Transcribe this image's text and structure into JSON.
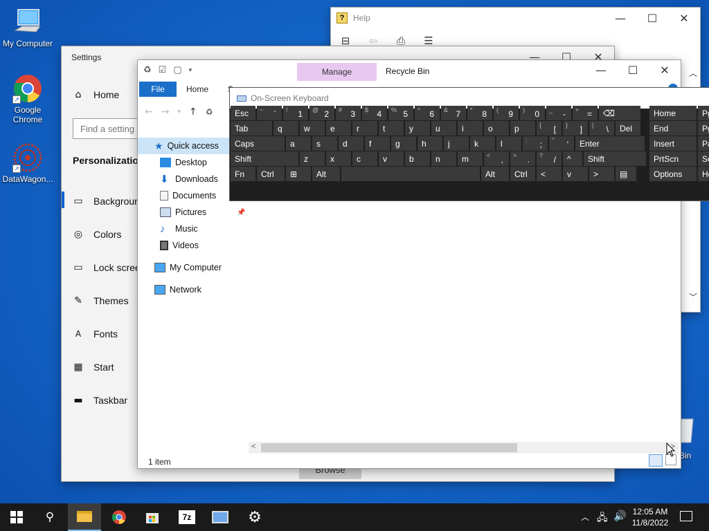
{
  "desktop": {
    "icons": [
      {
        "label": "My Computer"
      },
      {
        "label": "Google Chrome"
      },
      {
        "label": "DataWagon..."
      },
      {
        "label": "Bin"
      }
    ]
  },
  "help": {
    "title": "Help"
  },
  "settings": {
    "title": "Settings",
    "home": "Home",
    "search_placeholder": "Find a setting",
    "section": "Personalization",
    "nav": [
      {
        "label": "Background"
      },
      {
        "label": "Colors"
      },
      {
        "label": "Lock screen"
      },
      {
        "label": "Themes"
      },
      {
        "label": "Fonts"
      },
      {
        "label": "Start"
      },
      {
        "label": "Taskbar"
      }
    ],
    "browse": "Browse"
  },
  "explorer": {
    "manage": "Manage",
    "title": "Recycle Bin",
    "tabs": {
      "file": "File",
      "home": "Home",
      "share": "S"
    },
    "nav": {
      "quick_access": "Quick access",
      "desktop": "Desktop",
      "downloads": "Downloads",
      "documents": "Documents",
      "pictures": "Pictures",
      "music": "Music",
      "videos": "Videos",
      "my_computer": "My Computer",
      "network": "Network"
    },
    "status": "1 item"
  },
  "osk": {
    "title": "On-Screen Keyboard",
    "rows": [
      [
        [
          "Esc",
          ""
        ],
        [
          "`",
          "~"
        ],
        [
          "1",
          "!"
        ],
        [
          "2",
          "@"
        ],
        [
          "3",
          "#"
        ],
        [
          "4",
          "$"
        ],
        [
          "5",
          "%"
        ],
        [
          "6",
          "^"
        ],
        [
          "7",
          "&"
        ],
        [
          "8",
          "*"
        ],
        [
          "9",
          "("
        ],
        [
          "0",
          ")"
        ],
        [
          "-",
          "_"
        ],
        [
          "=",
          "+"
        ],
        [
          "⌫",
          ""
        ]
      ],
      [
        [
          "Tab",
          ""
        ],
        [
          "q",
          ""
        ],
        [
          "w",
          ""
        ],
        [
          "e",
          ""
        ],
        [
          "r",
          ""
        ],
        [
          "t",
          ""
        ],
        [
          "y",
          ""
        ],
        [
          "u",
          ""
        ],
        [
          "i",
          ""
        ],
        [
          "o",
          ""
        ],
        [
          "p",
          ""
        ],
        [
          "[",
          "{"
        ],
        [
          "]",
          "}"
        ],
        [
          "\\",
          "|"
        ],
        [
          "Del",
          ""
        ]
      ],
      [
        [
          "Caps",
          ""
        ],
        [
          "a",
          ""
        ],
        [
          "s",
          ""
        ],
        [
          "d",
          ""
        ],
        [
          "f",
          ""
        ],
        [
          "g",
          ""
        ],
        [
          "h",
          ""
        ],
        [
          "j",
          ""
        ],
        [
          "k",
          ""
        ],
        [
          "l",
          ""
        ],
        [
          ";",
          ":"
        ],
        [
          "'",
          "\""
        ],
        [
          "Enter",
          ""
        ]
      ],
      [
        [
          "Shift",
          ""
        ],
        [
          "z",
          ""
        ],
        [
          "x",
          ""
        ],
        [
          "c",
          ""
        ],
        [
          "v",
          ""
        ],
        [
          "b",
          ""
        ],
        [
          "n",
          ""
        ],
        [
          "m",
          ""
        ],
        [
          ",",
          "<"
        ],
        [
          ".",
          ">"
        ],
        [
          "/",
          "?"
        ],
        [
          "^",
          ""
        ],
        [
          "Shift",
          ""
        ]
      ],
      [
        [
          "Fn",
          ""
        ],
        [
          "Ctrl",
          ""
        ],
        [
          "⊞",
          ""
        ],
        [
          "Alt",
          ""
        ],
        [
          "",
          ""
        ],
        [
          "Alt",
          ""
        ],
        [
          "Ctrl",
          ""
        ],
        [
          "<",
          ""
        ],
        [
          "v",
          ""
        ],
        [
          ">",
          ""
        ],
        [
          "▤",
          ""
        ]
      ]
    ],
    "side": [
      [
        "Home",
        "Pg"
      ],
      [
        "End",
        "Pg"
      ],
      [
        "Insert",
        "Pa"
      ],
      [
        "PrtScn",
        "Sc"
      ],
      [
        "Options",
        "He"
      ]
    ]
  },
  "taskbar": {
    "time": "12:05 AM",
    "date": "11/8/2022"
  }
}
